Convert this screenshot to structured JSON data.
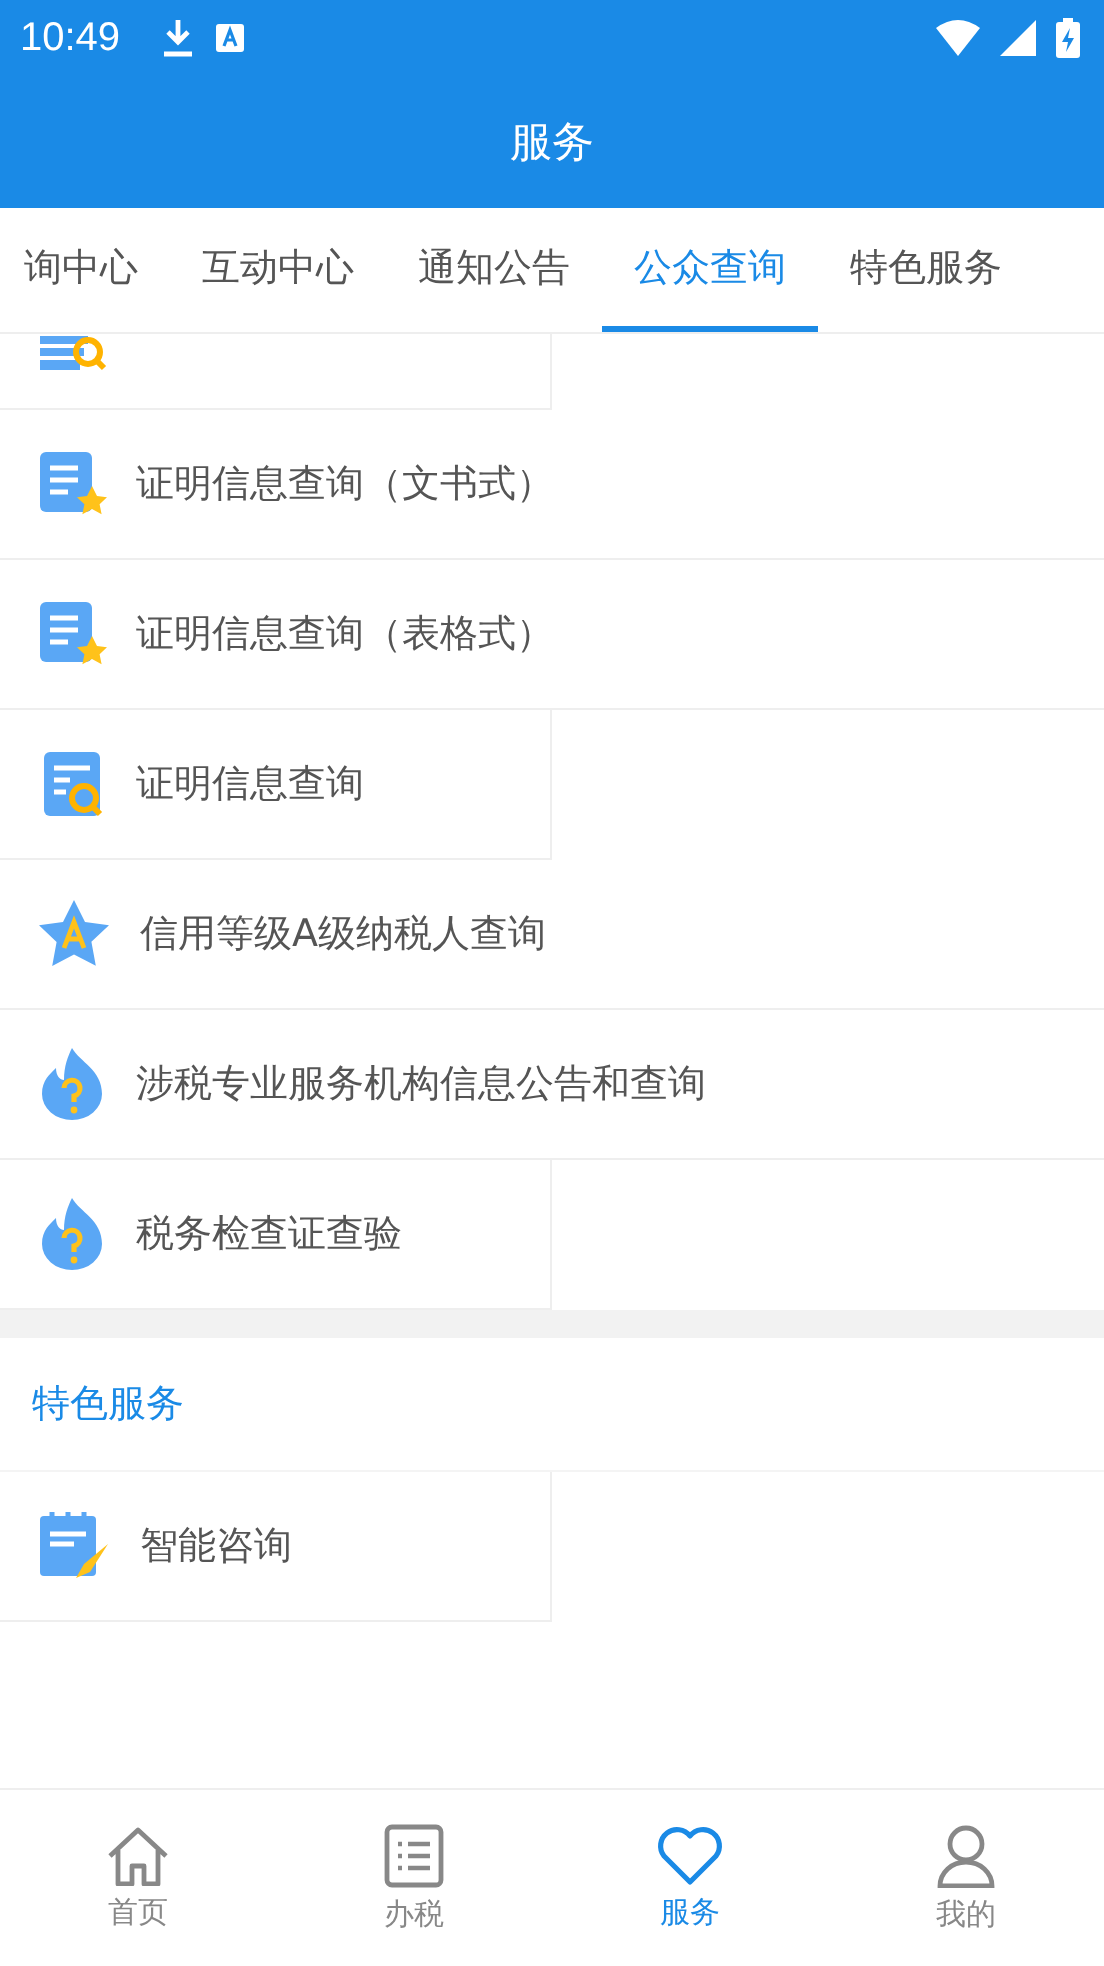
{
  "status_bar": {
    "time": "10:49"
  },
  "header": {
    "title": "服务"
  },
  "tabs": [
    {
      "label": "询中心",
      "selected": false
    },
    {
      "label": "互动中心",
      "selected": false
    },
    {
      "label": "通知公告",
      "selected": false
    },
    {
      "label": "公众查询",
      "selected": true
    },
    {
      "label": "特色服务",
      "selected": false
    }
  ],
  "sections": [
    {
      "items": [
        {
          "kind": "database-search"
        },
        {
          "label": "证明信息查询（文书式）",
          "kind": "doc-star"
        },
        {
          "label": "证明信息查询（表格式）",
          "kind": "doc-star"
        },
        {
          "label": "证明信息查询",
          "kind": "doc-search"
        },
        {
          "label": "信用等级A级纳税人查询",
          "kind": "star-a"
        },
        {
          "label": "涉税专业服务机构信息公告和查询",
          "kind": "flame-question"
        },
        {
          "label": "税务检查证查验",
          "kind": "flame-question"
        }
      ]
    },
    {
      "title": "特色服务",
      "items": [
        {
          "label": "智能咨询",
          "kind": "notepad-pen"
        }
      ]
    }
  ],
  "bottom_nav": [
    {
      "label": "首页",
      "kind": "home",
      "selected": false
    },
    {
      "label": "办税",
      "kind": "list",
      "selected": false
    },
    {
      "label": "服务",
      "kind": "heart",
      "selected": true
    },
    {
      "label": "我的",
      "kind": "person",
      "selected": false
    }
  ]
}
